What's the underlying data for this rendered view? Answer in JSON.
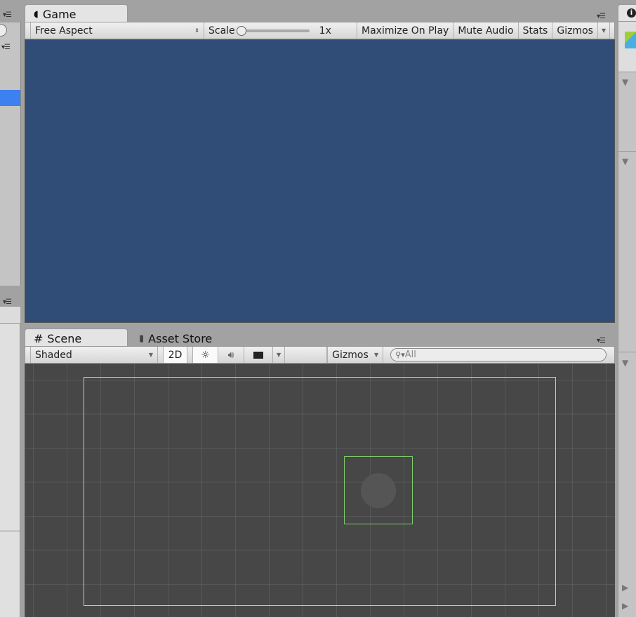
{
  "game": {
    "tab": "Game",
    "aspect": "Free Aspect",
    "scale_label": "Scale",
    "scale_value": "1x",
    "scale_fraction": 0,
    "maximize": "Maximize On Play",
    "mute": "Mute Audio",
    "stats": "Stats",
    "gizmos": "Gizmos",
    "bg": "#2f4d77"
  },
  "scene": {
    "tab": "Scene",
    "asset_store_tab": "Asset Store",
    "shading": "Shaded",
    "mode_2d": "2D",
    "gizmos": "Gizmos",
    "search_placeholder": "All",
    "bg": "#474747"
  },
  "inspector": {
    "icon": "info-icon"
  }
}
